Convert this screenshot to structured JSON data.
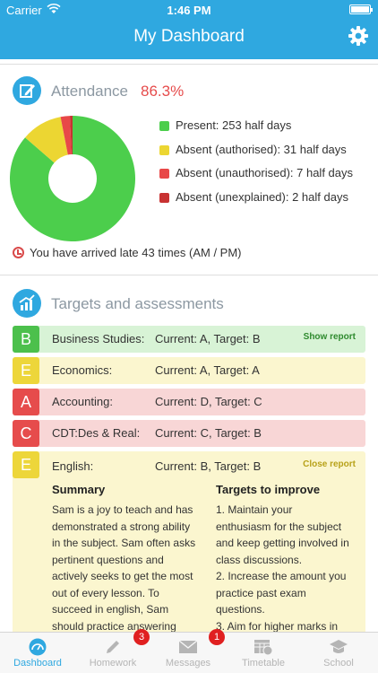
{
  "status": {
    "carrier": "Carrier",
    "time": "1:46 PM"
  },
  "header": {
    "title": "My Dashboard",
    "settings_icon": "gear-icon"
  },
  "attendance": {
    "title": "Attendance",
    "percent": "86.3%",
    "icon": "edit-icon",
    "legend": [
      {
        "label": "Present: 253 half days",
        "value": 253,
        "color": "#4cce4c"
      },
      {
        "label": "Absent (authorised): 31 half days",
        "value": 31,
        "color": "#ecd632"
      },
      {
        "label": "Absent (unauthorised): 7 half days",
        "value": 7,
        "color": "#e84848"
      },
      {
        "label": "Absent (unexplained): 2 half days",
        "value": 2,
        "color": "#c83232"
      }
    ],
    "late_text": "You have arrived late 43 times (AM / PM)"
  },
  "targets": {
    "title": "Targets and assessments",
    "icon": "chart-icon",
    "rows": [
      {
        "grade": "B",
        "subject": "Business Studies:",
        "current": "Current: A, Target: B",
        "action": "Show report",
        "color": "#4cc04c",
        "bg": "#d8f3d6",
        "action_color": "#2e8a2e"
      },
      {
        "grade": "E",
        "subject": "Economics:",
        "current": "Current: A, Target: A",
        "action": "",
        "color": "#edd63a",
        "bg": "#fbf6cf",
        "action_color": ""
      },
      {
        "grade": "A",
        "subject": "Accounting:",
        "current": "Current: D, Target: C",
        "action": "",
        "color": "#e64c4c",
        "bg": "#f8d6d6",
        "action_color": ""
      },
      {
        "grade": "C",
        "subject": "CDT:Des & Real:",
        "current": "Current: C, Target: B",
        "action": "",
        "color": "#e64c4c",
        "bg": "#f8d6d6",
        "action_color": ""
      }
    ],
    "expanded": {
      "grade": "E",
      "subject": "English:",
      "current": "Current: B, Target: B",
      "action": "Close report",
      "summary_title": "Summary",
      "summary_lines": [
        "Sam is a joy to teach and has",
        "demonstrated a strong ability",
        "in the subject. Sam often asks",
        "pertinent questions and",
        "actively seeks to get the most",
        "out of every lesson. To",
        "succeed in english, Sam",
        "should practice answering"
      ],
      "improve_title": "Targets to improve",
      "improve_lines": [
        "1. Maintain your",
        "enthusiasm for the subject",
        "and keep getting involved in",
        "class discussions.",
        "2. Increase the amount you",
        "practice past exam",
        "questions.",
        "3. Aim for higher marks in"
      ]
    }
  },
  "tabs": [
    {
      "label": "Dashboard",
      "icon": "dashboard-icon",
      "badge": ""
    },
    {
      "label": "Homework",
      "icon": "pencil-icon",
      "badge": "3"
    },
    {
      "label": "Messages",
      "icon": "envelope-icon",
      "badge": "1"
    },
    {
      "label": "Timetable",
      "icon": "calendar-clock-icon",
      "badge": ""
    },
    {
      "label": "School",
      "icon": "graduation-cap-icon",
      "badge": ""
    }
  ]
}
